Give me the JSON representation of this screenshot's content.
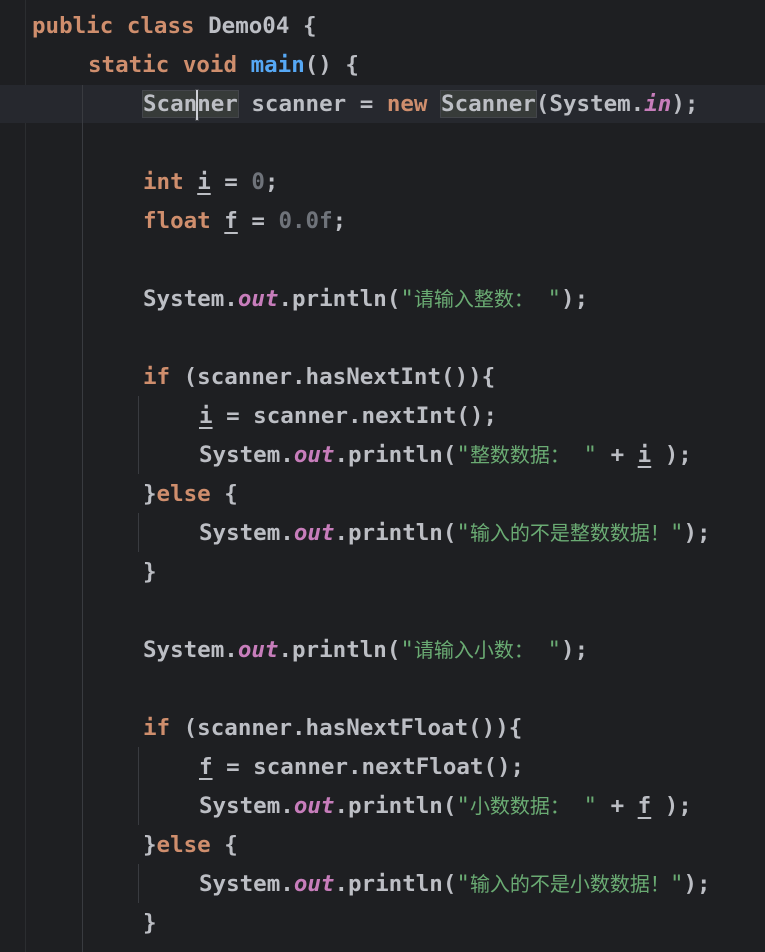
{
  "code": {
    "l1": {
      "kw1": "public",
      "kw2": "class",
      "name": "Demo04",
      "brace": "{"
    },
    "l2": {
      "kw1": "static",
      "kw2": "void",
      "fn": "main",
      "rest": "() {"
    },
    "l3": {
      "type_a": "Scan",
      "type_b": "ner",
      "var": "scanner",
      "eq": "=",
      "kw": "new",
      "type": "Scanner",
      "open": "(System.",
      "field": "in",
      "close": ");"
    },
    "l5": {
      "kw": "int",
      "var": "i",
      "eq": "=",
      "num": "0",
      "semi": ";"
    },
    "l6": {
      "kw": "float",
      "var": "f",
      "eq": "=",
      "num": "0.0f",
      "semi": ";"
    },
    "l8": {
      "pre": "System.",
      "field": "out",
      "call": ".println(",
      "q1": "\"",
      "text": "请输入整数：",
      "q2": " \"",
      "close": ");"
    },
    "l10": {
      "kw": "if",
      "rest": "(scanner.hasNextInt()){"
    },
    "l11": {
      "var": "i",
      "rest": " = scanner.nextInt();"
    },
    "l12": {
      "pre": "System.",
      "field": "out",
      "call": ".println(",
      "q1": "\"",
      "text": "整数数据：",
      "q2": " \"",
      "plus": " + ",
      "var": "i",
      "close": " );"
    },
    "l13": {
      "brace": "}",
      "kw": "else",
      "rest": " {"
    },
    "l14": {
      "pre": "System.",
      "field": "out",
      "call": ".println(",
      "q1": "\"",
      "text": "输入的不是整数数据！",
      "q2": "\"",
      "close": ");"
    },
    "l15": {
      "brace": "}"
    },
    "l17": {
      "pre": "System.",
      "field": "out",
      "call": ".println(",
      "q1": "\"",
      "text": "请输入小数：",
      "q2": " \"",
      "close": ");"
    },
    "l19": {
      "kw": "if",
      "rest": "(scanner.hasNextFloat()){"
    },
    "l20": {
      "var": "f",
      "rest": " = scanner.nextFloat();"
    },
    "l21": {
      "pre": "System.",
      "field": "out",
      "call": ".println(",
      "q1": "\"",
      "text": "小数数据：",
      "q2": " \"",
      "plus": " + ",
      "var": "f",
      "close": " );"
    },
    "l22": {
      "brace": "}",
      "kw": "else",
      "rest": " {"
    },
    "l23": {
      "pre": "System.",
      "field": "out",
      "call": ".println(",
      "q1": "\"",
      "text": "输入的不是小数数据！",
      "q2": "\"",
      "close": ");"
    },
    "l24": {
      "brace": "}"
    }
  },
  "colors": {
    "background": "#1e1f22",
    "keyword": "#cf8e6d",
    "function": "#56a8f5",
    "string": "#6aab73",
    "field": "#c77dbb",
    "default": "#bcbec4"
  }
}
